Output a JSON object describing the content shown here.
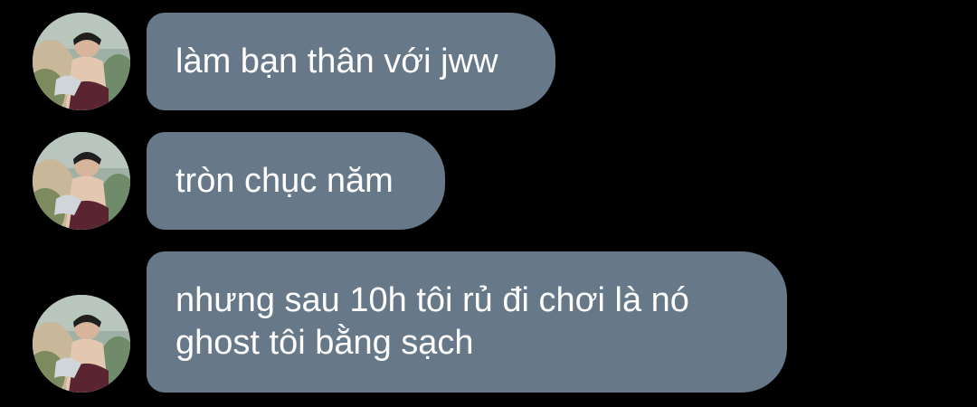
{
  "chat": {
    "messages": [
      {
        "text": "làm bạn thân với jww"
      },
      {
        "text": "tròn chục năm"
      },
      {
        "text": "nhưng sau 10h tôi rủ đi chơi là nó\nghost tôi bằng sạch"
      }
    ]
  },
  "colors": {
    "background": "#000000",
    "bubble": "#677889",
    "text": "#ffffff"
  }
}
